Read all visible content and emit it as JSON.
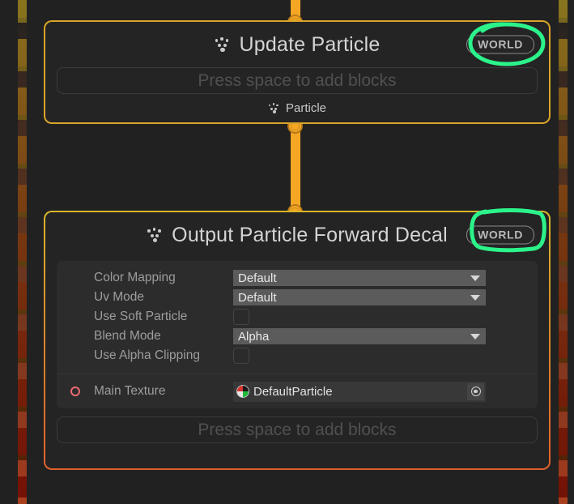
{
  "canvas": {
    "background": "#212121",
    "boundary_rail_color_top": "#8a761e",
    "boundary_rail_color_bottom": "#a8401e"
  },
  "link": {
    "color": "#f5a623",
    "port_icon": "connection-port-circle"
  },
  "nodes": [
    {
      "id": "update-particle",
      "title": "Update Particle",
      "icon": "particle-icon",
      "space_badge": "WORLD",
      "border_color": "#d9a528",
      "add_block_placeholder": "Press space to add blocks",
      "flow_label": "Particle",
      "flow_icon": "particle-icon",
      "annotated": true
    },
    {
      "id": "output-particle-forward-decal",
      "title": "Output Particle Forward Decal",
      "icon": "particle-icon",
      "space_badge": "WORLD",
      "border_color_top": "#d9b62a",
      "border_color_bottom": "#e2602c",
      "add_block_placeholder": "Press space to add blocks",
      "annotated": true,
      "properties": [
        {
          "label": "Color Mapping",
          "type": "dropdown",
          "value": "Default"
        },
        {
          "label": "Uv Mode",
          "type": "dropdown",
          "value": "Default"
        },
        {
          "label": "Use Soft Particle",
          "type": "checkbox",
          "value": false
        },
        {
          "label": "Blend Mode",
          "type": "dropdown",
          "value": "Alpha"
        },
        {
          "label": "Use Alpha Clipping",
          "type": "checkbox",
          "value": false
        }
      ],
      "object_property": {
        "label": "Main Texture",
        "value": "DefaultParticle",
        "port_color": "#ef6a72",
        "thumbnail_icon": "texture-preview-icon",
        "picker_icon": "object-picker-icon"
      }
    }
  ],
  "annotations": [
    {
      "id": "annotation-world-1",
      "shape": "hand-drawn-ellipse",
      "color": "#2bf38a",
      "target": "WORLD"
    },
    {
      "id": "annotation-world-2",
      "shape": "hand-drawn-rectangle",
      "color": "#2bf38a",
      "target": "WORLD"
    }
  ]
}
